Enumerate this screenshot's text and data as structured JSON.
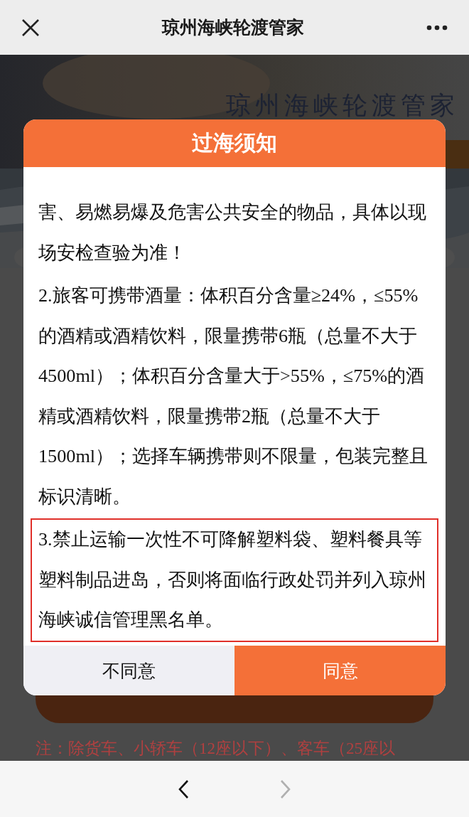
{
  "nav_bar": {
    "title": "琼州海峡轮渡管家"
  },
  "background_page": {
    "banner_title": "琼州海峡轮渡管家",
    "note": "注：除货车、小轿车（12座以下）、客车（25座以"
  },
  "dialog": {
    "title": "过海须知",
    "paragraphs": [
      {
        "text": "害、易燃易爆及危害公共安全的物品，具体以现场安检查验为准！",
        "highlighted": false
      },
      {
        "text": "2.旅客可携带酒量：体积百分含量≥24%，≤55%的酒精或酒精饮料，限量携带6瓶（总量不大于4500ml）；体积百分含量大于>55%，≤75%的酒精或酒精饮料，限量携带2瓶（总量不大于1500ml）；选择车辆携带则不限量，包装完整且标识清晰。",
        "highlighted": false
      },
      {
        "text": "3.禁止运输一次性不可降解塑料袋、塑料餐具等塑料制品进岛，否则将面临行政处罚并列入琼州海峡诚信管理黑名单。",
        "highlighted": true
      }
    ],
    "buttons": [
      {
        "label": "不同意",
        "kind": "secondary"
      },
      {
        "label": "同意",
        "kind": "primary"
      }
    ]
  },
  "bottom_bar": {
    "back_disabled": false,
    "forward_disabled": true
  }
}
